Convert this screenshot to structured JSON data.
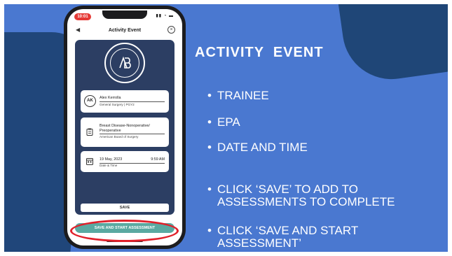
{
  "phone": {
    "status_time": "10:01",
    "nav": {
      "title": "Activity Event"
    },
    "trainee": {
      "initials": "AK",
      "name": "Alex  Kerrolla",
      "detail": "General Surgery | PGY2"
    },
    "epa": {
      "title": "Breast Disease-Nonoperative/ Preoperative",
      "board": "American Board of Surgery"
    },
    "datetime": {
      "date": "19 May, 2023",
      "time": "9:59 AM",
      "label": "Date & Time"
    },
    "save_label": "SAVE",
    "save_start_label": "SAVE AND START ASSESSMENT"
  },
  "slide": {
    "heading": "ACTIVITY  EVENT",
    "bullets": [
      "TRAINEE",
      "EPA",
      "DATE AND TIME",
      "CLICK ‘SAVE’ TO ADD TO\nASSESSMENTS TO COMPLETE",
      "CLICK ‘SAVE AND START\nASSESSMENT’"
    ]
  },
  "colors": {
    "background": "#4a78d0",
    "accent_dark": "#20467a",
    "panel": "#2c3e63",
    "start_button": "#5aa9a1",
    "highlight": "#e0202a"
  },
  "icons": [
    "back-arrow-icon",
    "close-icon",
    "clipboard-icon",
    "calendar-icon",
    "seal-logo"
  ]
}
